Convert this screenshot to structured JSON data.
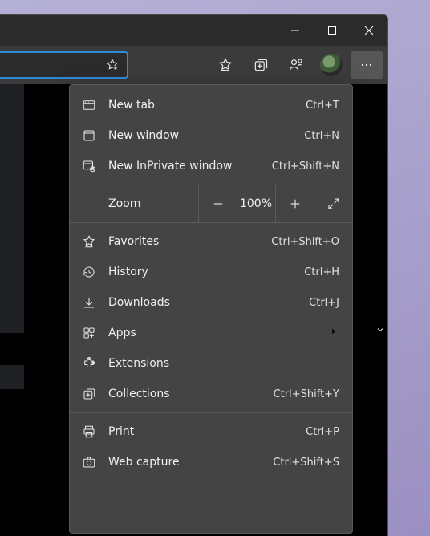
{
  "menu": {
    "new_tab": {
      "label": "New tab",
      "shortcut": "Ctrl+T"
    },
    "new_window": {
      "label": "New window",
      "shortcut": "Ctrl+N"
    },
    "new_inprivate": {
      "label": "New InPrivate window",
      "shortcut": "Ctrl+Shift+N"
    },
    "zoom": {
      "label": "Zoom",
      "value": "100%"
    },
    "favorites": {
      "label": "Favorites",
      "shortcut": "Ctrl+Shift+O"
    },
    "history": {
      "label": "History",
      "shortcut": "Ctrl+H"
    },
    "downloads": {
      "label": "Downloads",
      "shortcut": "Ctrl+J"
    },
    "apps": {
      "label": "Apps"
    },
    "extensions": {
      "label": "Extensions"
    },
    "collections": {
      "label": "Collections",
      "shortcut": "Ctrl+Shift+Y"
    },
    "print": {
      "label": "Print",
      "shortcut": "Ctrl+P"
    },
    "web_capture": {
      "label": "Web capture",
      "shortcut": "Ctrl+Shift+S"
    }
  }
}
